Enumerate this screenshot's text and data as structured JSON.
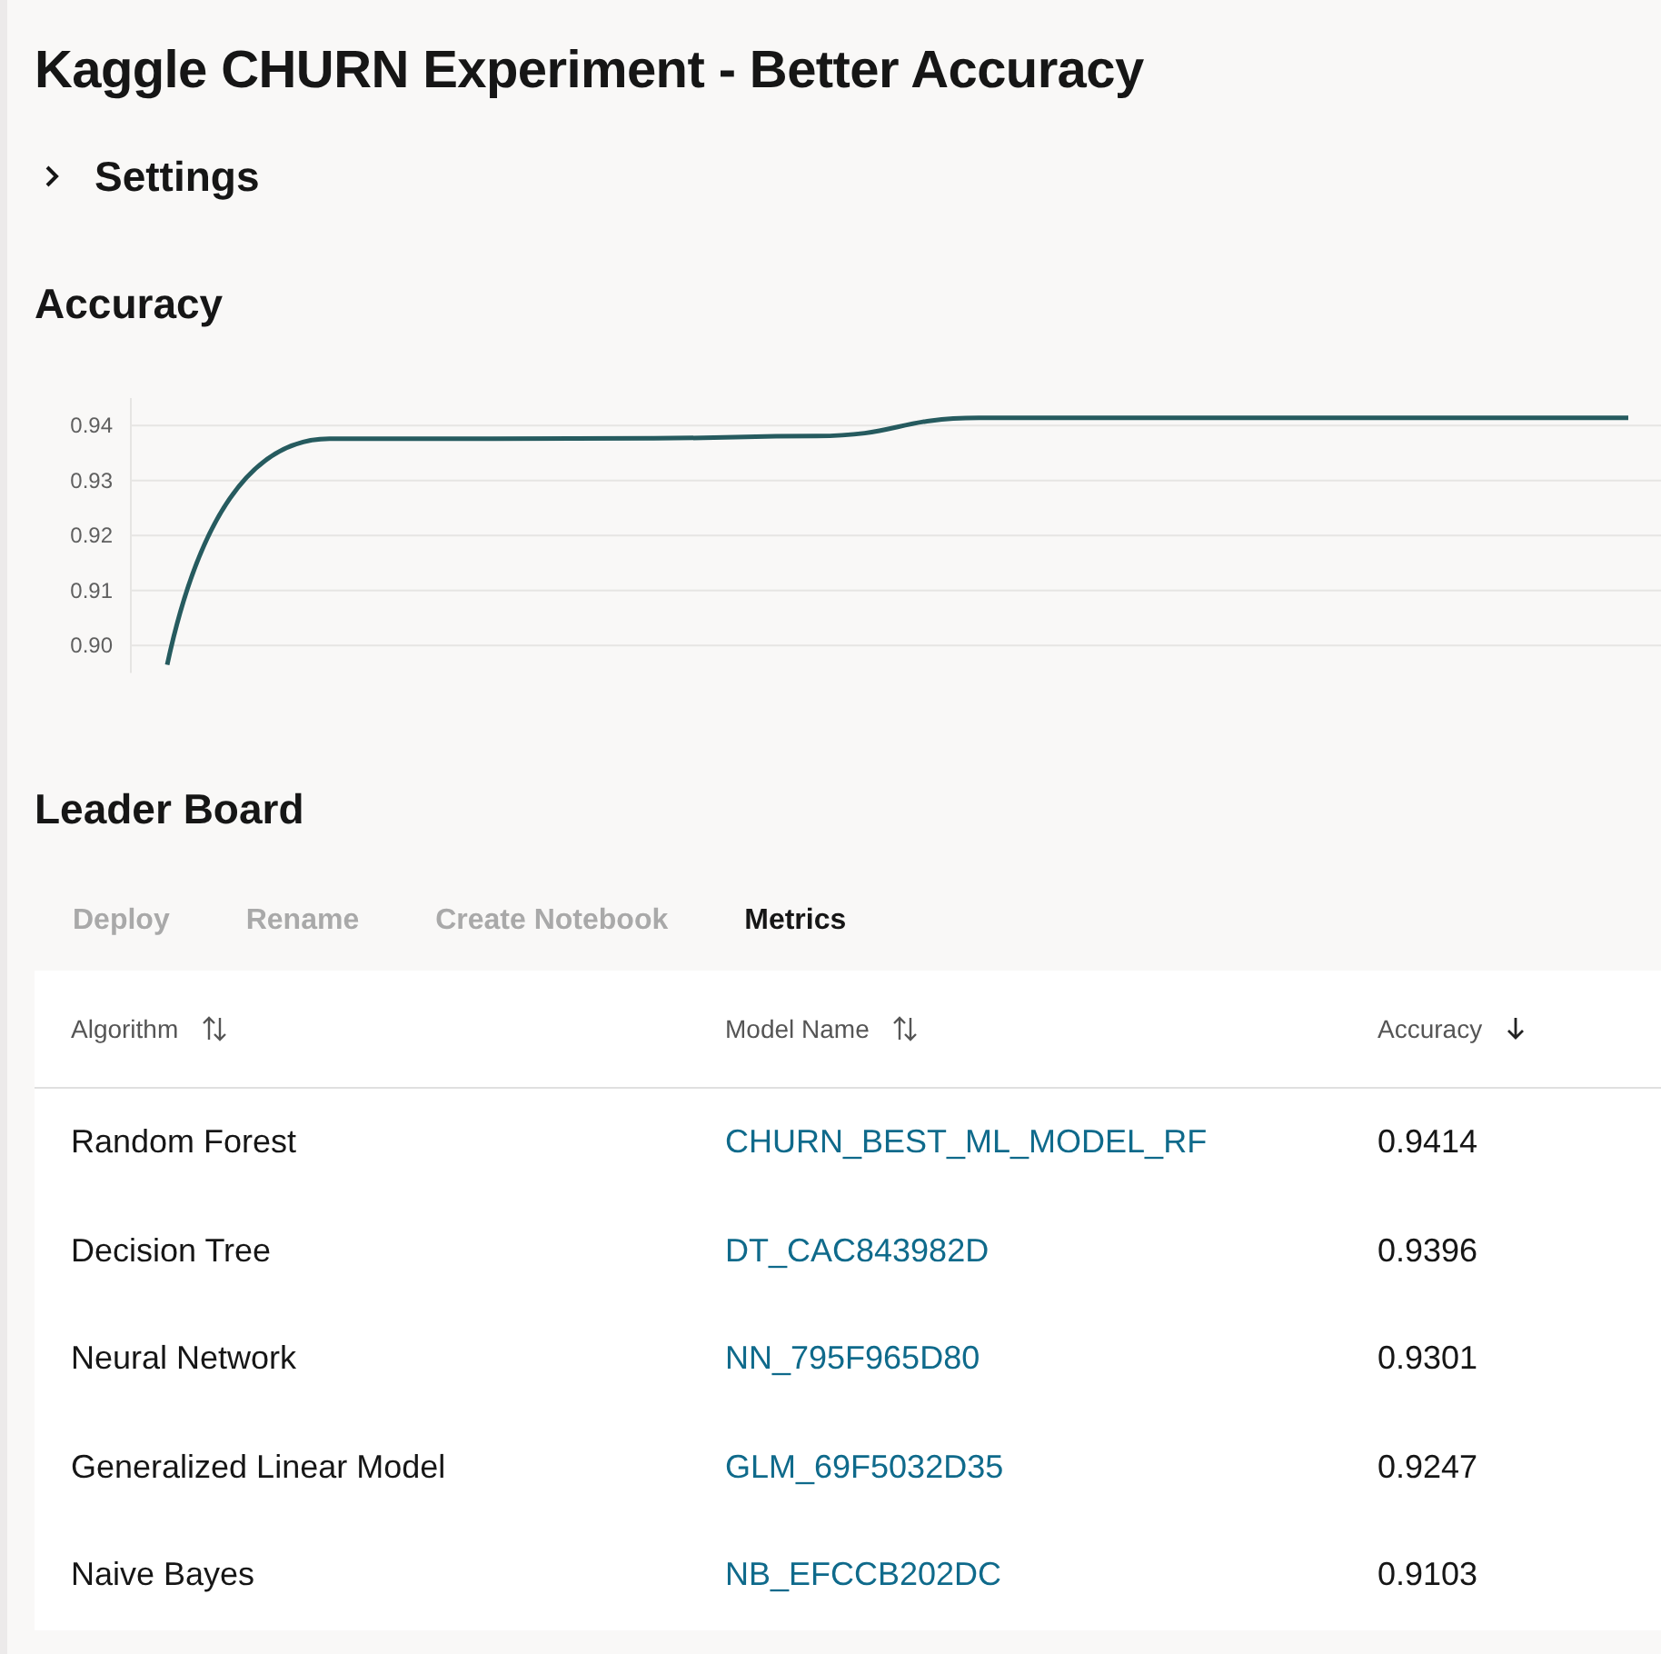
{
  "title": "Kaggle CHURN Experiment - Better Accuracy",
  "settings": {
    "label": "Settings",
    "expanded": false
  },
  "accuracy": {
    "heading": "Accuracy",
    "chart_data": {
      "type": "line",
      "grid": true,
      "ylim": [
        0.895,
        0.945
      ],
      "series": [
        {
          "color": "#265b5f",
          "values": [
            0.8965,
            0.9376,
            0.9376,
            0.9377,
            0.9381,
            0.9414,
            0.9414,
            0.9414,
            0.9414,
            0.9414
          ]
        }
      ],
      "yticks": [
        {
          "value": 0.9,
          "label": "0.90"
        },
        {
          "value": 0.91,
          "label": "0.91"
        },
        {
          "value": 0.92,
          "label": "0.92"
        },
        {
          "value": 0.93,
          "label": "0.93"
        },
        {
          "value": 0.94,
          "label": "0.94"
        }
      ]
    }
  },
  "leader_board": {
    "heading": "Leader Board",
    "actions": [
      {
        "label": "Deploy",
        "disabled": true
      },
      {
        "label": "Rename",
        "disabled": true
      },
      {
        "label": "Create Notebook",
        "disabled": true
      },
      {
        "label": "Metrics",
        "disabled": false
      }
    ],
    "columns": [
      {
        "label": "Algorithm",
        "kind": "sortable"
      },
      {
        "label": "Model Name",
        "kind": "sortable"
      },
      {
        "label": "Accuracy",
        "kind": "sorted"
      }
    ],
    "rows": [
      [
        "Random Forest",
        "CHURN_BEST_ML_MODEL_RF",
        "0.9414"
      ],
      [
        "Decision Tree",
        "DT_CAC843982D",
        "0.9396"
      ],
      [
        "Neural Network",
        "NN_795F965D80",
        "0.9301"
      ],
      [
        "Generalized Linear Model",
        "GLM_69F5032D35",
        "0.9247"
      ],
      [
        "Naive Bayes",
        "NB_EFCCB202DC",
        "0.9103"
      ]
    ]
  }
}
